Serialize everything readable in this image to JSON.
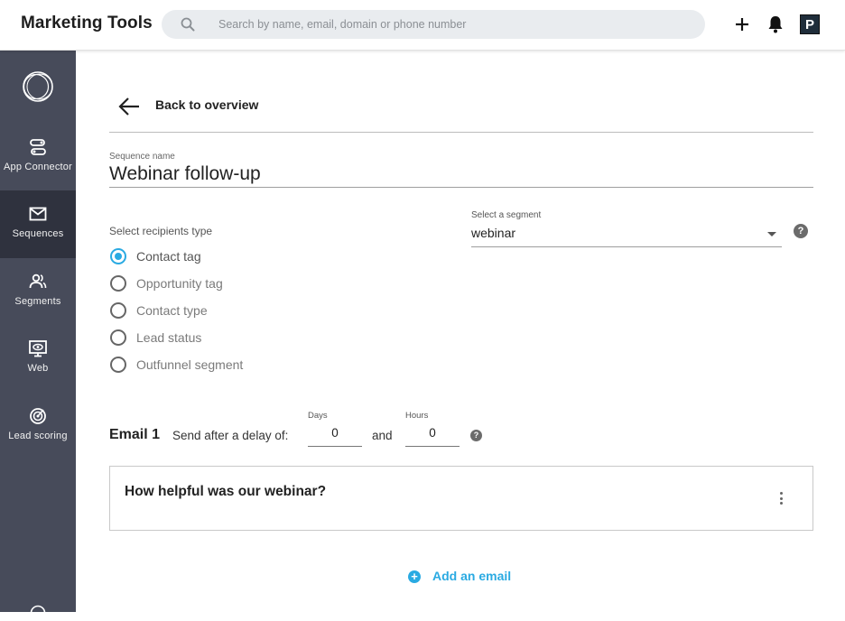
{
  "header": {
    "title": "Marketing Tools",
    "search_placeholder": "Search by name, email, domain or phone number",
    "avatar_letter": "P"
  },
  "sidebar": {
    "items": [
      {
        "label": "App Connector",
        "icon": "app-connector-icon",
        "active": false
      },
      {
        "label": "Sequences",
        "icon": "mail-icon",
        "active": true
      },
      {
        "label": "Segments",
        "icon": "users-icon",
        "active": false
      },
      {
        "label": "Web",
        "icon": "monitor-eye-icon",
        "active": false
      },
      {
        "label": "Lead scoring",
        "icon": "target-icon",
        "active": false
      }
    ]
  },
  "main": {
    "back_label": "Back to overview",
    "sequence_name_label": "Sequence name",
    "sequence_name_value": "Webinar follow-up",
    "recipients_label": "Select recipients type",
    "recipient_options": [
      {
        "label": "Contact tag",
        "checked": true
      },
      {
        "label": "Opportunity tag",
        "checked": false
      },
      {
        "label": "Contact type",
        "checked": false
      },
      {
        "label": "Lead status",
        "checked": false
      },
      {
        "label": "Outfunnel segment",
        "checked": false
      }
    ],
    "segment_label": "Select a segment",
    "segment_value": "webinar",
    "help_glyph": "?",
    "email": {
      "title": "Email 1",
      "send_after_label": "Send after a delay of:",
      "days_label": "Days",
      "days_value": "0",
      "and_label": "and",
      "hours_label": "Hours",
      "hours_value": "0",
      "subject": "How helpful was our webinar?"
    },
    "add_email_label": "Add an email",
    "accent_color": "#2aaae2"
  }
}
